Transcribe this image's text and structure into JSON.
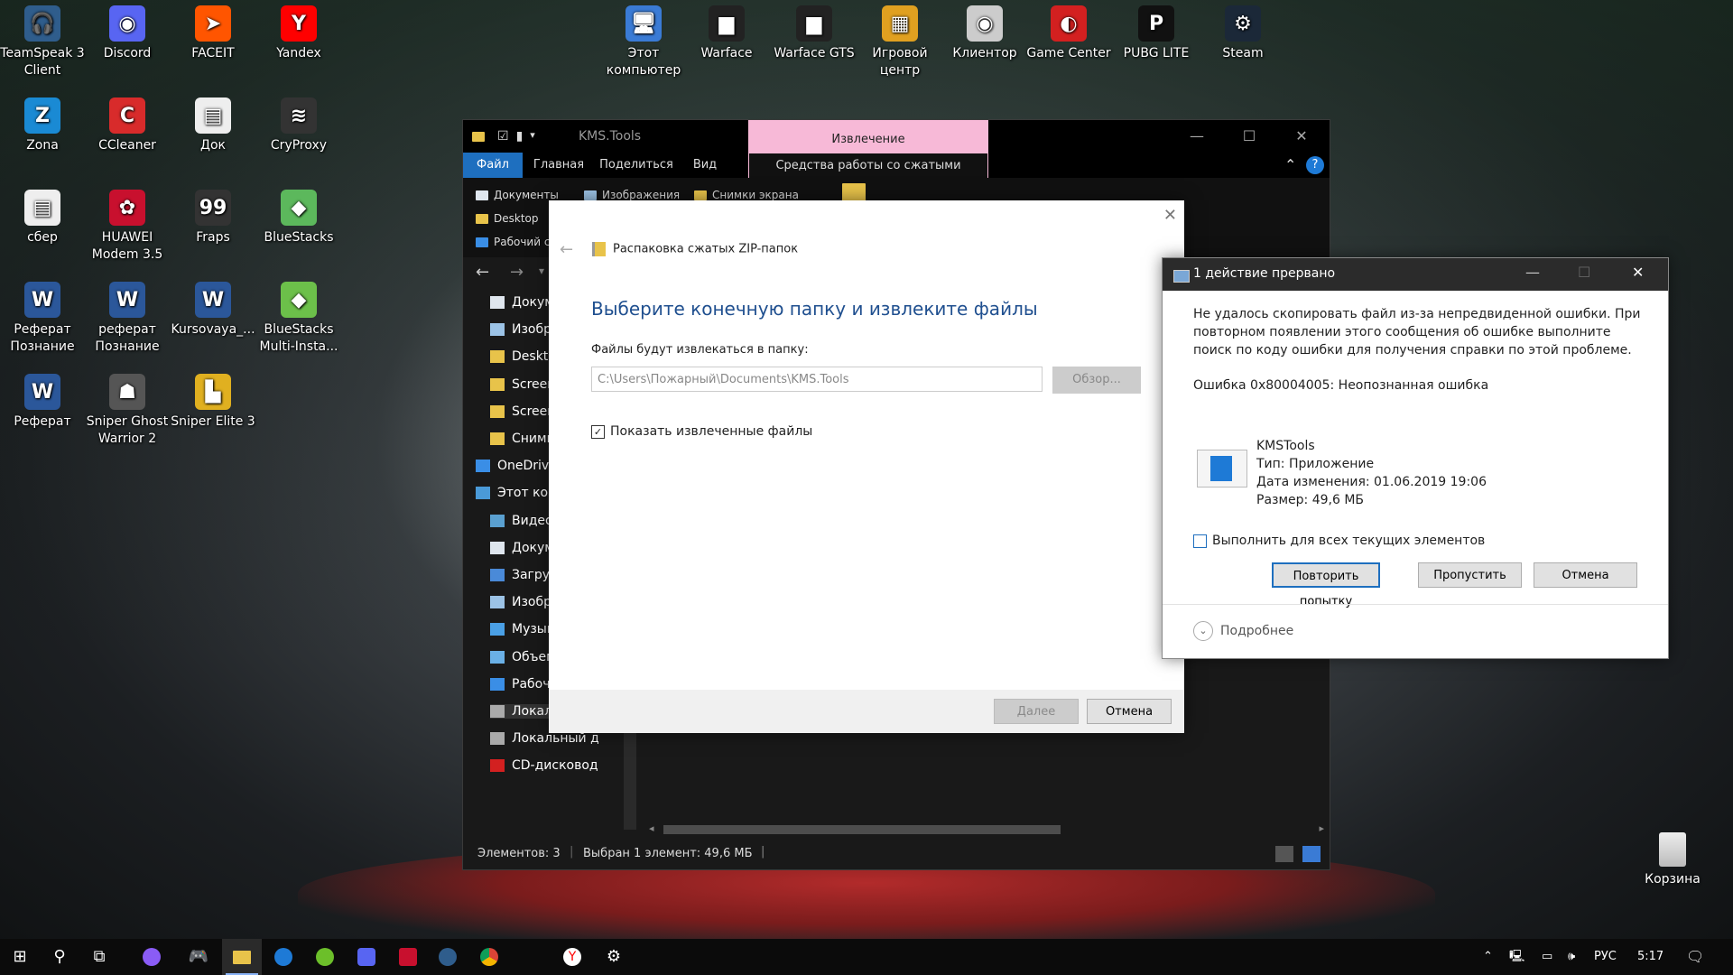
{
  "desktop": {
    "icons": [
      {
        "label": "TeamSpeak 3 Client",
        "glyph": "🎧",
        "color": "#2f5d8c"
      },
      {
        "label": "Discord",
        "glyph": "◉",
        "color": "#5865f2"
      },
      {
        "label": "FACEIT",
        "glyph": "➤",
        "color": "#ff5500"
      },
      {
        "label": "Yandex",
        "glyph": "Y",
        "color": "#ff0000"
      },
      {
        "label": "Zona",
        "glyph": "Z",
        "color": "#1a8ad4"
      },
      {
        "label": "CCleaner",
        "glyph": "C",
        "color": "#d82b2b"
      },
      {
        "label": "Док",
        "glyph": "▤",
        "color": "#eeeeee"
      },
      {
        "label": "CryProxy",
        "glyph": "≋",
        "color": "#333333"
      },
      {
        "label": "сбер",
        "glyph": "▤",
        "color": "#eeeeee"
      },
      {
        "label": "HUAWEI Modem 3.5",
        "glyph": "✿",
        "color": "#c8102e"
      },
      {
        "label": "Fraps",
        "glyph": "99",
        "color": "#333333"
      },
      {
        "label": "BlueStacks",
        "glyph": "◆",
        "color": "#5cb85c"
      },
      {
        "label": "Реферат Познание",
        "glyph": "W",
        "color": "#2b579a"
      },
      {
        "label": "реферат Познание",
        "glyph": "W",
        "color": "#2b579a"
      },
      {
        "label": "Kursovaya_...",
        "glyph": "W",
        "color": "#2b579a"
      },
      {
        "label": "BlueStacks Multi-Insta...",
        "glyph": "◆",
        "color": "#6cc04a"
      },
      {
        "label": "Реферат",
        "glyph": "W",
        "color": "#2b579a"
      },
      {
        "label": "Sniper Ghost Warrior 2",
        "glyph": "☗",
        "color": "#555555"
      },
      {
        "label": "Sniper Elite 3",
        "glyph": "▙",
        "color": "#e0b020"
      }
    ],
    "top_icons": [
      {
        "label": "Этот компьютер",
        "glyph": "🖥",
        "color": "#3a7bd5"
      },
      {
        "label": "Warface",
        "glyph": "▆",
        "color": "#222222"
      },
      {
        "label": "Warface GTS",
        "glyph": "▆",
        "color": "#222222"
      },
      {
        "label": "Игровой центр",
        "glyph": "▦",
        "color": "#e0a020"
      },
      {
        "label": "Клиентор",
        "glyph": "◉",
        "color": "#cccccc"
      },
      {
        "label": "Game Center",
        "glyph": "◐",
        "color": "#d32020"
      },
      {
        "label": "PUBG LITE",
        "glyph": "P",
        "color": "#111111"
      },
      {
        "label": "Steam",
        "glyph": "⚙",
        "color": "#1b2838"
      }
    ],
    "recycle_label": "Корзина"
  },
  "explorer": {
    "title": "KMS.Tools",
    "context_tab_group": "Извлечение",
    "tabs": [
      "Файл",
      "Главная",
      "Поделиться",
      "Вид"
    ],
    "context_tab": "Средства работы со сжатыми папками",
    "ribbon_items": [
      "Документы",
      "Изображения",
      "Снимки экрана",
      "Desktop",
      "Рабочий стол"
    ],
    "tree_items": [
      "Документы",
      "Изображения",
      "Desktop",
      "Screenshots",
      "Screenshots",
      "Снимки экрана",
      "OneDrive",
      "Этот компьютер",
      "Видео",
      "Документы",
      "Загрузки",
      "Изображения",
      "Музыка",
      "Объемные объекты",
      "Рабочий стол",
      "Локальный диск (C:)",
      "Локальный диск (D:)",
      "CD-дисковод (F:)"
    ],
    "status_items": "Элементов: 3",
    "status_selected": "Выбран 1 элемент: 49,6 МБ"
  },
  "zip_dialog": {
    "breadcrumb": "Распаковка сжатых ZIP-папок",
    "heading": "Выберите конечную папку и извлеките файлы",
    "folder_label": "Файлы будут извлекаться в папку:",
    "path_value": "C:\\Users\\Пожарный\\Documents\\KMS.Tools",
    "browse_label": "Обзор...",
    "show_files_label": "Показать извлеченные файлы",
    "next_label": "Далее",
    "cancel_label": "Отмена"
  },
  "error_dialog": {
    "title": "1 действие прервано",
    "message": "Не удалось скопировать файл из-за непредвиденной ошибки. При повторном появлении этого сообщения об ошибке выполните поиск по коду ошибки для получения справки по этой проблеме.",
    "error_code": "Ошибка 0x80004005: Неопознанная ошибка",
    "file_name": "KMSTools",
    "file_type": "Тип: Приложение",
    "file_modified": "Дата изменения: 01.06.2019 19:06",
    "file_size": "Размер: 49,6 МБ",
    "apply_all_label": "Выполнить для всех текущих элементов",
    "retry_label": "Повторить попытку",
    "skip_label": "Пропустить",
    "cancel_label": "Отмена",
    "details_label": "Подробнее"
  },
  "taskbar": {
    "language": "РУС",
    "time": "5:17"
  }
}
